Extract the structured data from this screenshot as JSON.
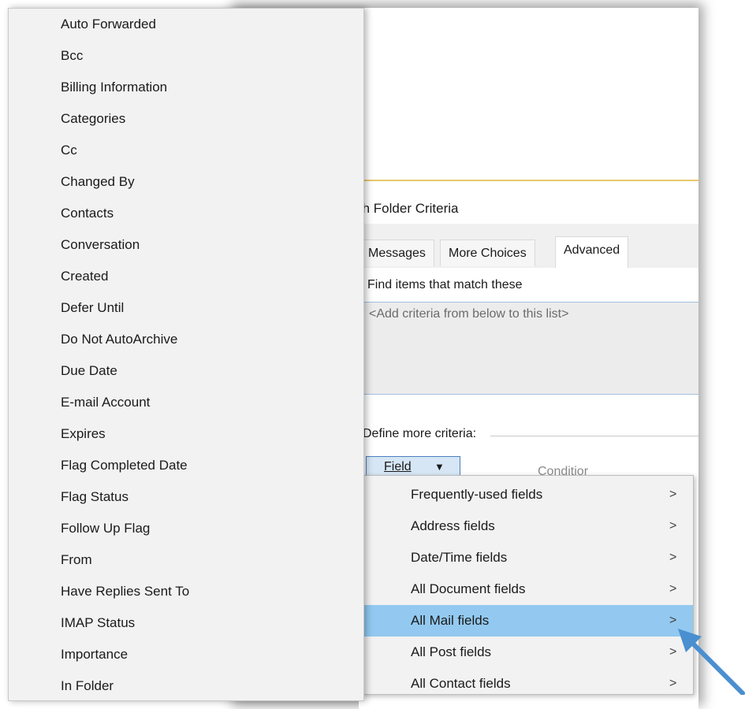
{
  "dialog": {
    "criteria_title": "arch Folder Criteria",
    "tabs": [
      {
        "label": "Messages"
      },
      {
        "label": "More Choices"
      },
      {
        "label": "Advanced"
      }
    ],
    "find_label": "Find items that match these",
    "criteria_placeholder": "<Add criteria from below to this list>",
    "define_label": "Define more criteria:",
    "field_button_label": "Field",
    "condition_label": "Conditior"
  },
  "field_list": {
    "items": [
      "Auto Forwarded",
      "Bcc",
      "Billing Information",
      "Categories",
      "Cc",
      "Changed By",
      "Contacts",
      "Conversation",
      "Created",
      "Defer Until",
      "Do Not AutoArchive",
      "Due Date",
      "E-mail Account",
      "Expires",
      "Flag Completed Date",
      "Flag Status",
      "Follow Up Flag",
      "From",
      "Have Replies Sent To",
      "IMAP Status",
      "Importance",
      "In Folder"
    ]
  },
  "field_menu": {
    "items": [
      {
        "label": "Frequently-used fields",
        "chevron": ">"
      },
      {
        "label": "Address fields",
        "chevron": ">"
      },
      {
        "label": "Date/Time fields",
        "chevron": ">"
      },
      {
        "label": "All Document fields",
        "chevron": ">"
      },
      {
        "label": "All Mail fields",
        "chevron": ">",
        "highlighted": true
      },
      {
        "label": "All Post fields",
        "chevron": ">"
      },
      {
        "label": "All Contact fields",
        "chevron": ">"
      }
    ]
  },
  "colors": {
    "highlight": "#93c9f0",
    "annotation_arrow": "#4a8fd0",
    "menu_bg": "#f2f2f2"
  }
}
